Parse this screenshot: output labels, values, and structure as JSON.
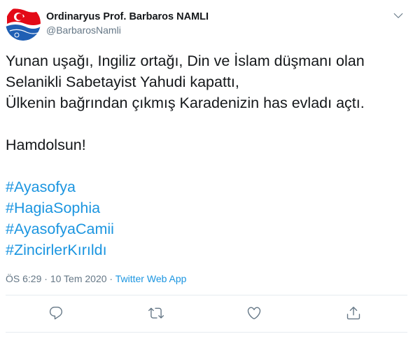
{
  "author": {
    "name": "Ordinaryus Prof. Barbaros NAMLI",
    "handle": "@BarbarosNamli",
    "avatar_icon": "turkish-flag-avatar",
    "colors": {
      "flag_red": "#e30a17",
      "flag_blue": "#1f5fb4"
    }
  },
  "tweet": {
    "lines": [
      "Yunan uşağı, Ingiliz ortağı, Din ve İslam düşmanı olan",
      "Selanikli Sabetayist Yahudi kapattı,",
      "Ülkenin bağrından çıkmış Karadenizin has evladı açtı."
    ],
    "closing": "Hamdolsun!",
    "hashtags": [
      "#Ayasofya",
      "#HagiaSophia",
      "#AyasofyaCamii",
      "#ZincirlerKırıldı"
    ]
  },
  "meta": {
    "time": "ÖS 6:29",
    "separator": " · ",
    "date": "10 Tem 2020",
    "source": "Twitter Web App"
  },
  "actions": [
    {
      "name": "reply-icon"
    },
    {
      "name": "retweet-icon"
    },
    {
      "name": "like-icon"
    },
    {
      "name": "share-icon"
    }
  ],
  "colors": {
    "text": "#14171a",
    "secondary": "#657786",
    "link": "#1b95e0",
    "divider": "#e6ecf0"
  }
}
